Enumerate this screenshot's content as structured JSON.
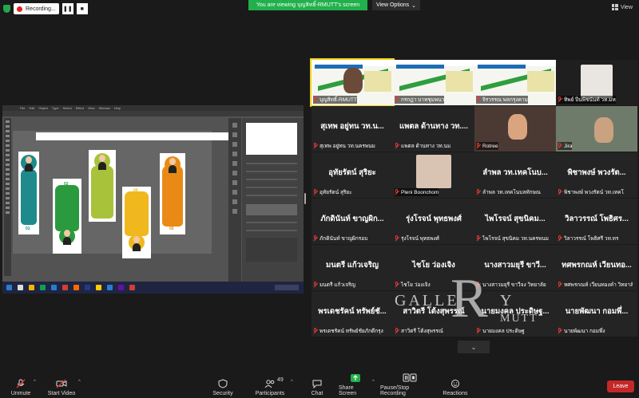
{
  "recording": {
    "label": "Recording...",
    "pause_icon": "pause-icon",
    "stop_icon": "stop-icon"
  },
  "banner": {
    "viewing_text": "You are viewing บุญสิทธิ์-RMUTT's screen",
    "view_options": "View Options"
  },
  "view_button": "View",
  "share": {
    "menu": [
      "File",
      "Edit",
      "Object",
      "Type",
      "Select",
      "Effect",
      "View",
      "Window",
      "Help"
    ],
    "cards": [
      {
        "num": "01",
        "color": "#1e8a8c"
      },
      {
        "num": "02",
        "color": "#2b9a3f"
      },
      {
        "num": "03",
        "color": "#a8c23a"
      },
      {
        "num": "04",
        "color": "#f0b81e"
      },
      {
        "num": "05",
        "color": "#e98a16"
      }
    ]
  },
  "gallery": [
    {
      "type": "slide",
      "label": "บุญสิทธิ์-RMUTT"
    },
    {
      "type": "slide",
      "label": "กรกฎา  บาทชุมพนา"
    },
    {
      "type": "slide",
      "label": "จิรวรรณ  พลกรุงคาม"
    },
    {
      "type": "cam",
      "label": "ทิพย์  ปิ่นพิชนันท์  วท.มห"
    },
    {
      "type": "name",
      "name": "สุเทพ  อยู่ทน  วท.น...",
      "label": "สุเทพ  อยู่ทน  วท.นครพนม"
    },
    {
      "type": "name",
      "name": "แพตล  ด้านทาง  วท....",
      "label": "แพตล  ด้านทาง  วท.นม"
    },
    {
      "type": "cam",
      "label": "Rotree"
    },
    {
      "type": "cam",
      "label": "Jira"
    },
    {
      "type": "name",
      "name": "อุทัยรัตน์  สุริยะ",
      "label": "อุทัยรัตน์  สุริยะ"
    },
    {
      "type": "cam",
      "label": "Pleni Boonchom"
    },
    {
      "type": "name",
      "name": "ลำพล  วท.เทคโนบ...",
      "label": "ลำพล  วท.เทคโนบลทักษณ"
    },
    {
      "type": "name",
      "name": "พิชาพงษ์  พวงรัต...",
      "label": "พิชาพงษ์  พวงรัตน์  วท.เทคโ"
    },
    {
      "type": "name",
      "name": "ภักดินันท์  ขาญผิก...",
      "label": "ภักดินันท์  ขาญผิกรอบ"
    },
    {
      "type": "name",
      "name": "รุ่งโรจน์  พุทธพงศ์",
      "label": "รุ่งโรจน์  พุทธพงศ์"
    },
    {
      "type": "name",
      "name": "ไพโรจน์  สุขนิคม...",
      "label": "ไพโรจน์  สุขนิคม  วท.นครพนม"
    },
    {
      "type": "name",
      "name": "วิลาวรรณ์  โพธิศร...",
      "label": "วิลาวรรณ์  โพธิศรี  วท.ทร"
    },
    {
      "type": "name",
      "name": "มนตรี  แก้วเจริญ",
      "label": "มนตรี  แก้วเจริญ"
    },
    {
      "type": "name",
      "name": "ไชโย  ว่องเจิง",
      "label": "ไชโย  ว่องเจิง"
    },
    {
      "type": "name",
      "name": "นางสาวมยุรี  ขาวี...",
      "label": "นางสาวมยุรี  ขาวีจง  วิทยาลัย"
    },
    {
      "type": "name",
      "name": "ทศพรกณห์  เวียนทอ...",
      "label": "ทศพรกณห์  เวียนทองคำ  วิทยาลัย"
    },
    {
      "type": "name",
      "name": "พรเดชรัคน์  ทรัพย์ชั...",
      "label": "พรเดชรัคน์  ทรัพย์ชัยภักดีกรุง"
    },
    {
      "type": "name",
      "name": "สาวิตรี  โต้งสุพรรณ์",
      "label": "สาวิตรี  โต้งสุพรรณ์"
    },
    {
      "type": "name",
      "name": "นายมงคล  ประดิษฐ...",
      "label": "นายมงคล  ประดิษฐ"
    },
    {
      "type": "name",
      "name": "นายพัฒนา  กอมพึ่...",
      "label": "นายพัฒนา  กอมพึ่ง"
    }
  ],
  "watermark": {
    "left": "GALLE",
    "big": "R",
    "right": "Y",
    "bottom": "MUTT"
  },
  "toolbar": {
    "unmute": "Unmute",
    "start_video": "Start Video",
    "security": "Security",
    "participants": "Participants",
    "participants_count": "49",
    "chat": "Chat",
    "share_screen": "Share Screen",
    "recording": "Pause/Stop Recording",
    "reactions": "Reactions",
    "leave": "Leave"
  },
  "colors": {
    "banner_green": "#21b04b",
    "leave_red": "#c52828",
    "muted_red": "#e53935"
  }
}
